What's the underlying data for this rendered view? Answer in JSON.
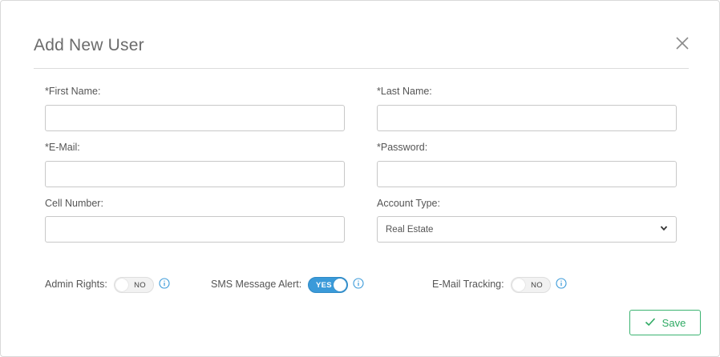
{
  "modal": {
    "title": "Add New User"
  },
  "fields": {
    "first_name": {
      "label": "*First Name:",
      "value": "",
      "placeholder": ""
    },
    "last_name": {
      "label": "*Last Name:",
      "value": "",
      "placeholder": ""
    },
    "email": {
      "label": "*E-Mail:",
      "value": "",
      "placeholder": ""
    },
    "password": {
      "label": "*Password:",
      "value": "",
      "placeholder": ""
    },
    "cell_number": {
      "label": "Cell Number:",
      "value": "",
      "placeholder": ""
    },
    "account_type": {
      "label": "Account Type:",
      "value": "Real Estate"
    }
  },
  "toggles": {
    "admin_rights": {
      "label": "Admin Rights:",
      "state": "NO"
    },
    "sms_alert": {
      "label": "SMS Message Alert:",
      "state": "YES"
    },
    "email_tracking": {
      "label": "E-Mail Tracking:",
      "state": "NO"
    }
  },
  "actions": {
    "save_label": "Save"
  },
  "colors": {
    "accent_blue": "#3a9ad9",
    "save_green": "#2eaa63"
  }
}
